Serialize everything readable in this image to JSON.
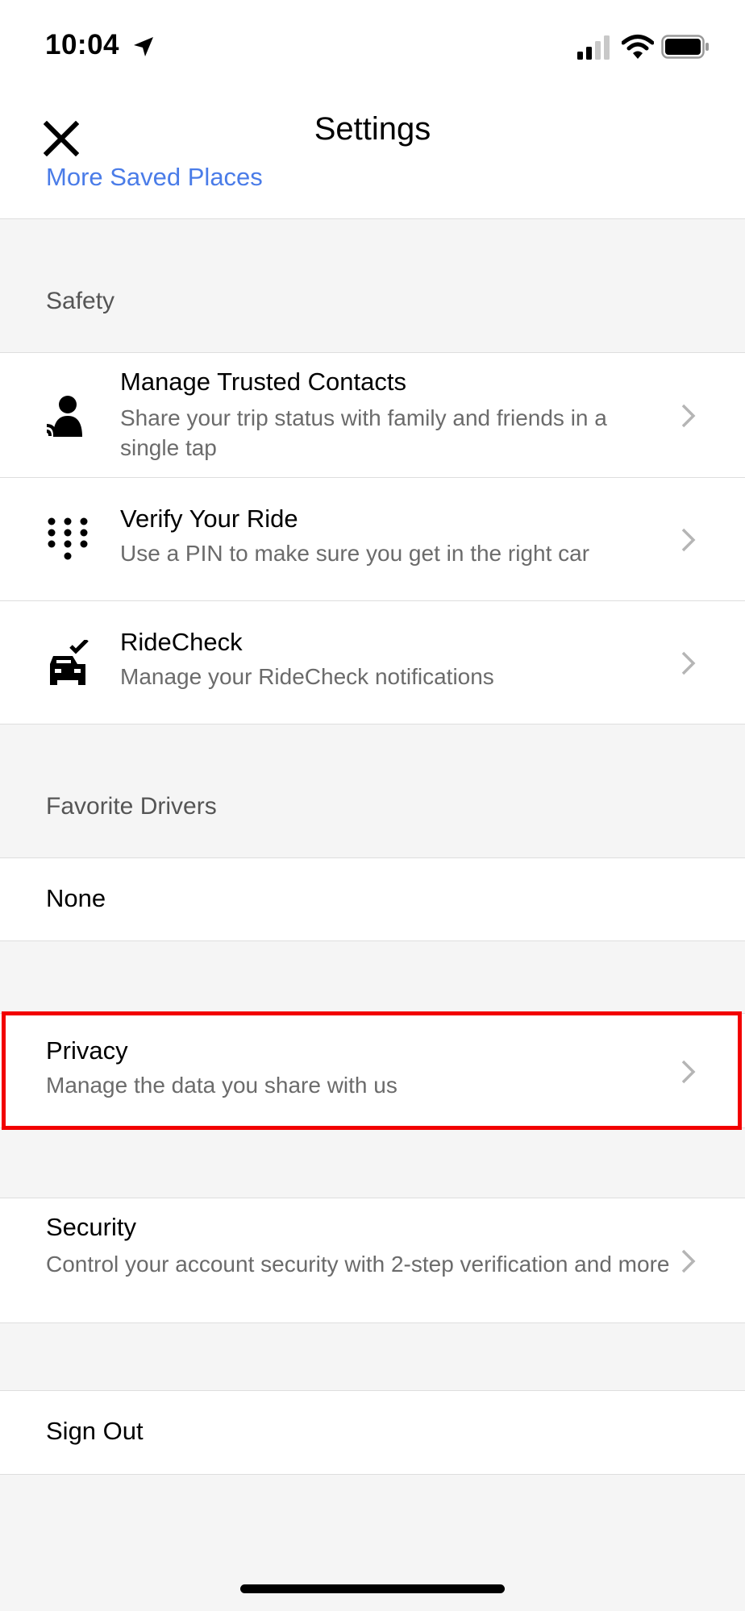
{
  "status_bar": {
    "time": "10:04"
  },
  "header": {
    "title": "Settings",
    "partial_item": "More Saved Places"
  },
  "safety": {
    "section_title": "Safety",
    "items": [
      {
        "title": "Manage Trusted Contacts",
        "subtitle": "Share your trip status with family and friends in a single tap",
        "icon": "trusted-contacts-icon"
      },
      {
        "title": "Verify Your Ride",
        "subtitle": "Use a PIN to make sure you get in the right car",
        "icon": "pin-keypad-icon"
      },
      {
        "title": "RideCheck",
        "subtitle": "Manage your RideCheck notifications",
        "icon": "car-check-icon"
      }
    ]
  },
  "favorite_drivers": {
    "section_title": "Favorite Drivers",
    "value": "None"
  },
  "privacy": {
    "title": "Privacy",
    "subtitle": "Manage the data you share with us"
  },
  "security": {
    "title": "Security",
    "subtitle": "Control your account security with 2-step verification and more"
  },
  "sign_out": {
    "label": "Sign Out"
  },
  "colors": {
    "link": "#4a7ce8",
    "danger": "#e0442f",
    "highlight": "#f20000",
    "background": "#f5f5f5"
  }
}
